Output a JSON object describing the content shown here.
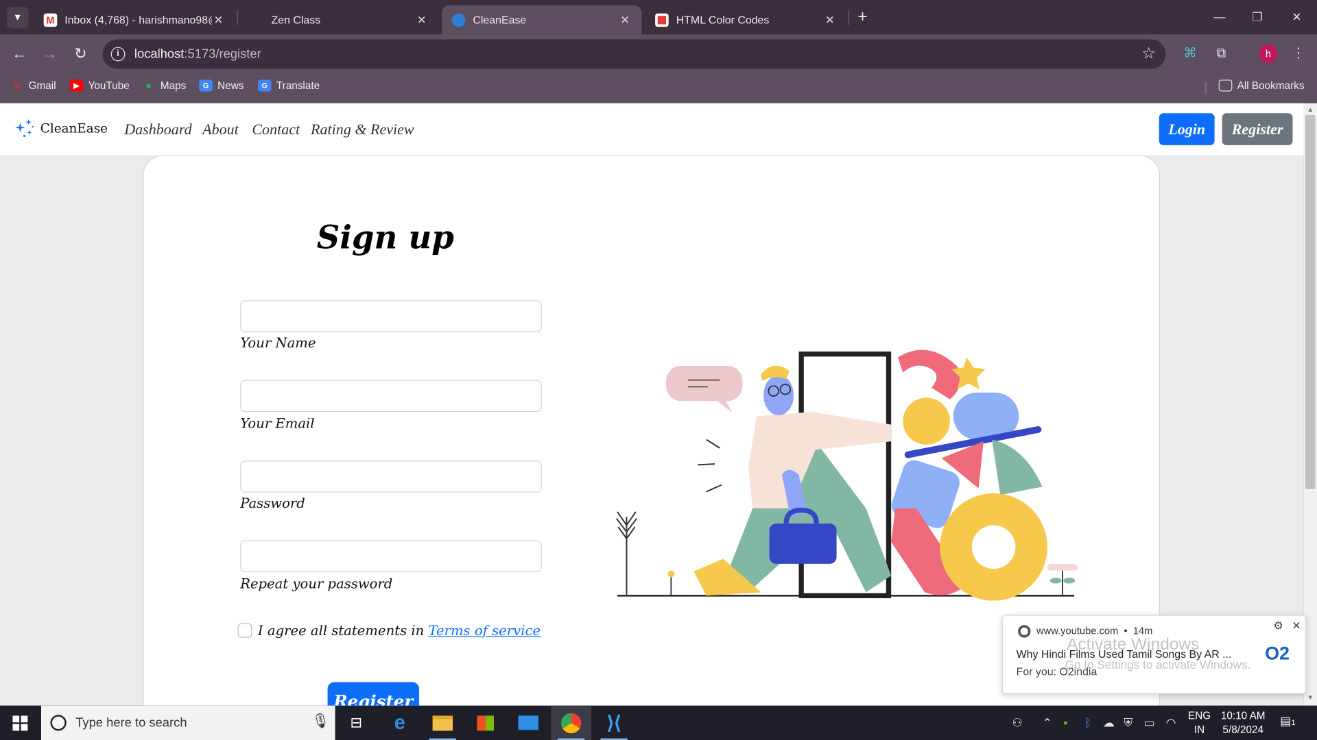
{
  "browser": {
    "tabs": [
      {
        "title": "Inbox (4,768) - harishmano98@",
        "favicon": "gmail-icon",
        "active": false
      },
      {
        "title": "Zen Class",
        "favicon": "zenclass-icon",
        "active": false
      },
      {
        "title": "CleanEase",
        "favicon": "cleanease-icon",
        "active": true
      },
      {
        "title": "HTML Color Codes",
        "favicon": "htmlcolorcodes-icon",
        "active": false
      }
    ],
    "url_host": "localhost",
    "url_path": ":5173/register",
    "profile_initial": "h",
    "bookmarks": [
      {
        "label": "Gmail",
        "icon": "gmail-icon",
        "color": "#d93025"
      },
      {
        "label": "YouTube",
        "icon": "youtube-icon",
        "color": "#ff0000"
      },
      {
        "label": "Maps",
        "icon": "maps-icon",
        "color": "#34a853"
      },
      {
        "label": "News",
        "icon": "news-icon",
        "color": "#4285f4"
      },
      {
        "label": "Translate",
        "icon": "translate-icon",
        "color": "#4285f4"
      }
    ],
    "all_bookmarks_label": "All Bookmarks"
  },
  "app": {
    "brand": "CleanEase",
    "nav_links": [
      "Dashboard",
      "About",
      "Contact",
      "Rating & Review"
    ],
    "login_label": "Login",
    "register_nav_label": "Register"
  },
  "form": {
    "title": "Sign up",
    "fields": [
      {
        "label": "Your Name",
        "value": ""
      },
      {
        "label": "Your Email",
        "value": ""
      },
      {
        "label": "Password",
        "value": ""
      },
      {
        "label": "Repeat your password",
        "value": ""
      }
    ],
    "terms_prefix": "I agree all statements in",
    "terms_link": "Terms of service",
    "terms_checked": false,
    "submit_label": "Register"
  },
  "notification": {
    "source": "www.youtube.com",
    "age": "14m",
    "title": "Why Hindi Films Used Tamil Songs By AR ...",
    "subtitle": "For you: O2india",
    "logo_text": "O2"
  },
  "watermark": {
    "line1": "Activate Windows",
    "line2": "Go to Settings to activate Windows."
  },
  "taskbar": {
    "search_placeholder": "Type here to search",
    "lang_line1": "ENG",
    "lang_line2": "IN",
    "time": "10:10 AM",
    "date": "5/8/2024",
    "notification_count": "1"
  },
  "colors": {
    "primary": "#0d6efd",
    "secondary": "#6c757d",
    "browser_frame": "#3b2f3d",
    "browser_toolbar": "#5d4e60"
  }
}
